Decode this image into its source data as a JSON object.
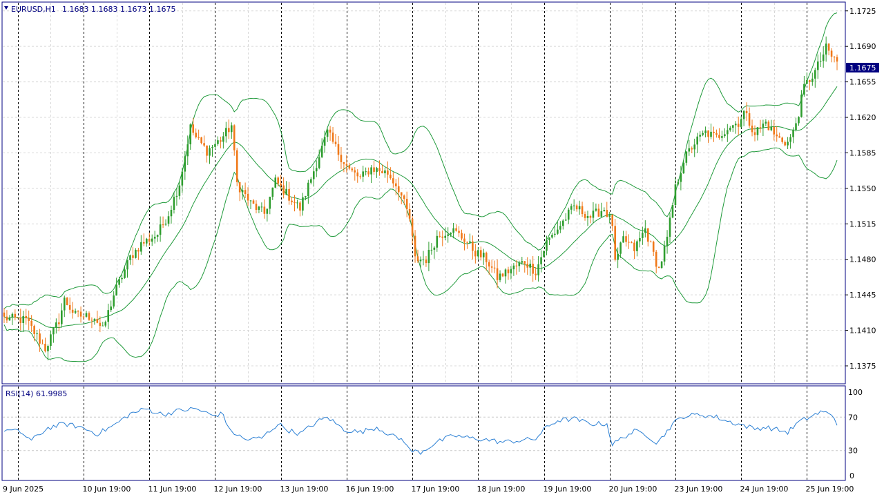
{
  "header": {
    "symbol": "EURUSD,H1",
    "ohlc": "1.1683 1.1683 1.1673 1.1675"
  },
  "rsi_header": "RSI(14) 61.9985",
  "current_price": "1.1675",
  "colors": {
    "bull": "#2e9d2e",
    "bear": "#f07818",
    "band": "#1f9a3a",
    "rsi": "#2a7fd4",
    "grid": "#d8d8d8",
    "frame": "#000080",
    "price_tag_bg": "#000080"
  },
  "chart_data": [
    {
      "type": "candlestick",
      "symbol": "EURUSD",
      "timeframe": "H1",
      "ylim": [
        1.1358,
        1.1733
      ],
      "y_ticks": [
        "1.1725",
        "1.1690",
        "1.1655",
        "1.1620",
        "1.1585",
        "1.1550",
        "1.1515",
        "1.1480",
        "1.1445",
        "1.1410",
        "1.1375"
      ],
      "x_ticks": [
        "9 Jun 2025",
        "10 Jun 19:00",
        "11 Jun 19:00",
        "12 Jun 19:00",
        "13 Jun 19:00",
        "16 Jun 19:00",
        "17 Jun 19:00",
        "18 Jun 19:00",
        "19 Jun 19:00",
        "20 Jun 19:00",
        "23 Jun 19:00",
        "24 Jun 19:00",
        "25 Jun 19:00"
      ],
      "indicators": [
        "Bollinger Bands"
      ],
      "close_path": [
        [
          0,
          1.1422
        ],
        [
          8,
          1.142
        ],
        [
          15,
          1.1392
        ],
        [
          20,
          1.142
        ],
        [
          22,
          1.144
        ],
        [
          26,
          1.1425
        ],
        [
          33,
          1.1423
        ],
        [
          36,
          1.141
        ],
        [
          40,
          1.1445
        ],
        [
          46,
          1.1482
        ],
        [
          50,
          1.1495
        ],
        [
          56,
          1.1505
        ],
        [
          60,
          1.1525
        ],
        [
          64,
          1.1555
        ],
        [
          68,
          1.161
        ],
        [
          70,
          1.16
        ],
        [
          74,
          1.1587
        ],
        [
          79,
          1.1598
        ],
        [
          83,
          1.1612
        ],
        [
          85,
          1.1555
        ],
        [
          90,
          1.1535
        ],
        [
          95,
          1.1525
        ],
        [
          99,
          1.1557
        ],
        [
          103,
          1.1545
        ],
        [
          108,
          1.153
        ],
        [
          112,
          1.156
        ],
        [
          118,
          1.1605
        ],
        [
          122,
          1.1585
        ],
        [
          126,
          1.1568
        ],
        [
          130,
          1.156
        ],
        [
          134,
          1.157
        ],
        [
          140,
          1.1565
        ],
        [
          144,
          1.155
        ],
        [
          148,
          1.152
        ],
        [
          150,
          1.148
        ],
        [
          154,
          1.148
        ],
        [
          158,
          1.1502
        ],
        [
          163,
          1.151
        ],
        [
          168,
          1.15
        ],
        [
          172,
          1.1487
        ],
        [
          176,
          1.148
        ],
        [
          180,
          1.1462
        ],
        [
          185,
          1.147
        ],
        [
          190,
          1.1478
        ],
        [
          194,
          1.1468
        ],
        [
          198,
          1.1497
        ],
        [
          202,
          1.151
        ],
        [
          208,
          1.1532
        ],
        [
          214,
          1.1522
        ],
        [
          219,
          1.153
        ],
        [
          222,
          1.1515
        ],
        [
          223,
          1.1475
        ],
        [
          226,
          1.15
        ],
        [
          230,
          1.149
        ],
        [
          234,
          1.151
        ],
        [
          237,
          1.1485
        ],
        [
          239,
          1.147
        ],
        [
          242,
          1.15
        ],
        [
          245,
          1.155
        ],
        [
          248,
          1.1578
        ],
        [
          252,
          1.1595
        ],
        [
          256,
          1.1605
        ],
        [
          260,
          1.16
        ],
        [
          264,
          1.161
        ],
        [
          268,
          1.1615
        ],
        [
          270,
          1.1625
        ],
        [
          274,
          1.1605
        ],
        [
          278,
          1.1615
        ],
        [
          282,
          1.16
        ],
        [
          286,
          1.1595
        ],
        [
          288,
          1.1605
        ],
        [
          290,
          1.1625
        ],
        [
          292,
          1.165
        ],
        [
          296,
          1.1665
        ],
        [
          300,
          1.1688
        ],
        [
          302,
          1.168
        ],
        [
          304,
          1.1675
        ]
      ]
    },
    {
      "type": "line",
      "name": "RSI(14)",
      "ylim": [
        0,
        100
      ],
      "y_ticks": [
        "100",
        "70",
        "30",
        "0"
      ],
      "levels": [
        70,
        30
      ],
      "path": [
        [
          0,
          55
        ],
        [
          6,
          52
        ],
        [
          10,
          42
        ],
        [
          16,
          57
        ],
        [
          22,
          62
        ],
        [
          28,
          58
        ],
        [
          34,
          50
        ],
        [
          40,
          60
        ],
        [
          46,
          74
        ],
        [
          52,
          80
        ],
        [
          58,
          73
        ],
        [
          64,
          78
        ],
        [
          70,
          80
        ],
        [
          76,
          72
        ],
        [
          80,
          74
        ],
        [
          82,
          55
        ],
        [
          88,
          43
        ],
        [
          94,
          45
        ],
        [
          100,
          62
        ],
        [
          104,
          54
        ],
        [
          108,
          50
        ],
        [
          114,
          64
        ],
        [
          118,
          70
        ],
        [
          124,
          55
        ],
        [
          130,
          52
        ],
        [
          136,
          58
        ],
        [
          142,
          47
        ],
        [
          146,
          42
        ],
        [
          148,
          30
        ],
        [
          152,
          28
        ],
        [
          158,
          40
        ],
        [
          164,
          48
        ],
        [
          170,
          45
        ],
        [
          176,
          43
        ],
        [
          182,
          40
        ],
        [
          188,
          42
        ],
        [
          194,
          44
        ],
        [
          198,
          58
        ],
        [
          202,
          66
        ],
        [
          208,
          68
        ],
        [
          214,
          62
        ],
        [
          220,
          62
        ],
        [
          222,
          37
        ],
        [
          226,
          46
        ],
        [
          230,
          53
        ],
        [
          234,
          50
        ],
        [
          238,
          40
        ],
        [
          240,
          45
        ],
        [
          244,
          62
        ],
        [
          248,
          71
        ],
        [
          254,
          73
        ],
        [
          260,
          70
        ],
        [
          264,
          65
        ],
        [
          270,
          60
        ],
        [
          274,
          56
        ],
        [
          278,
          58
        ],
        [
          282,
          55
        ],
        [
          286,
          52
        ],
        [
          290,
          64
        ],
        [
          294,
          70
        ],
        [
          298,
          76
        ],
        [
          302,
          74
        ],
        [
          304,
          63
        ]
      ]
    }
  ]
}
